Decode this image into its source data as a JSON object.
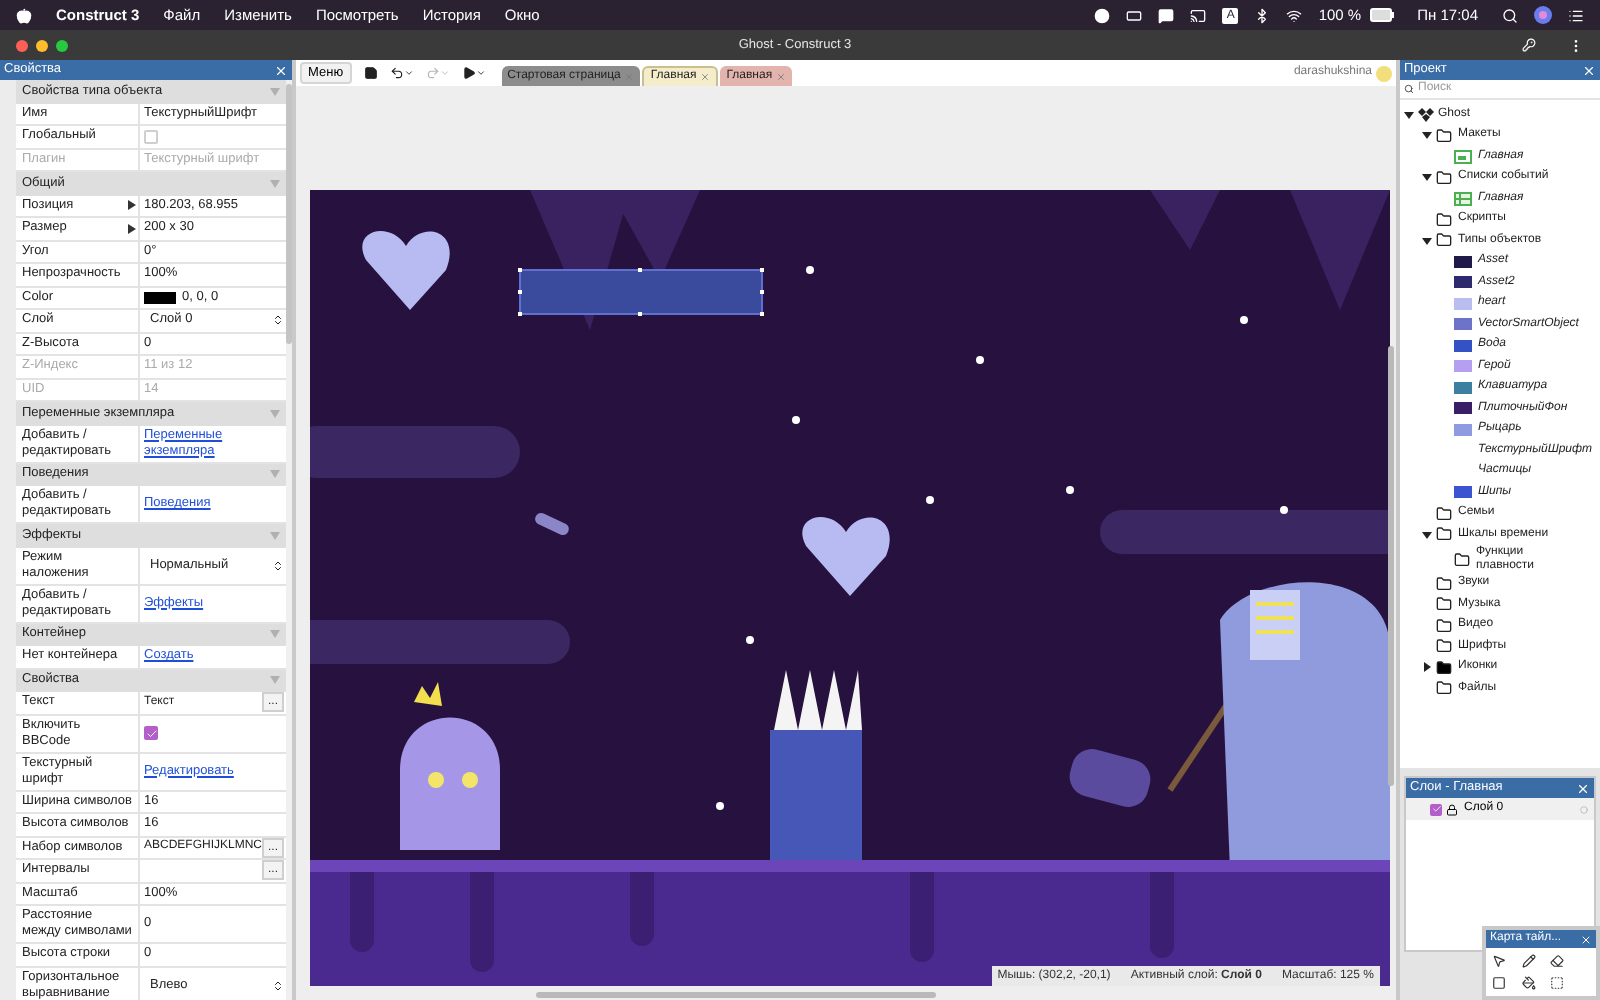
{
  "menubar": {
    "app": "Construct 3",
    "menus": [
      "Файл",
      "Изменить",
      "Посмотреть",
      "История",
      "Окно"
    ],
    "input_source": "A",
    "battery": "100 %",
    "clock": "Пн 17:04"
  },
  "window": {
    "title": "Ghost - Construct 3"
  },
  "properties_panel": {
    "title": "Свойства",
    "sections": [
      {
        "title": "Свойства типа объекта",
        "expanded": true,
        "rows": [
          {
            "kind": "text",
            "label": "Имя",
            "value": "ТекстурныйШрифт"
          },
          {
            "kind": "checkbox",
            "label": "Глобальный",
            "checked": false
          },
          {
            "kind": "readonly",
            "label": "Плагин",
            "value": "Текстурный шрифт"
          }
        ]
      },
      {
        "title": "Общий",
        "expanded": true,
        "rows": [
          {
            "kind": "vector",
            "label": "Позиция",
            "value": "180.203,  68.955"
          },
          {
            "kind": "vector",
            "label": "Размер",
            "value": "200 x 30"
          },
          {
            "kind": "text",
            "label": "Угол",
            "value": "0°"
          },
          {
            "kind": "text",
            "label": "Непрозрачность",
            "value": "100%"
          },
          {
            "kind": "color",
            "label": "Color",
            "value": "0, 0, 0",
            "color": "#000000"
          },
          {
            "kind": "select",
            "label": "Слой",
            "value": "Слой 0"
          },
          {
            "kind": "text",
            "label": "Z-Высота",
            "value": "0"
          },
          {
            "kind": "readonly",
            "label": "Z-Индекс",
            "value": "11 из 12"
          },
          {
            "kind": "readonly",
            "label": "UID",
            "value": "14"
          }
        ]
      },
      {
        "title": "Переменные экземпляра",
        "expanded": true,
        "rows": [
          {
            "kind": "link",
            "label": "Добавить / редактировать",
            "value": "Переменные экземпляра"
          }
        ]
      },
      {
        "title": "Поведения",
        "expanded": true,
        "rows": [
          {
            "kind": "link",
            "label": "Добавить / редактировать",
            "value": "Поведения"
          }
        ]
      },
      {
        "title": "Эффекты",
        "expanded": true,
        "rows": [
          {
            "kind": "select",
            "label": "Режим наложения",
            "value": "Нормальный"
          },
          {
            "kind": "link",
            "label": "Добавить / редактировать",
            "value": "Эффекты"
          }
        ]
      },
      {
        "title": "Контейнер",
        "expanded": true,
        "rows": [
          {
            "kind": "link",
            "label": "Нет контейнера",
            "value": "Создать"
          }
        ]
      },
      {
        "title": "Свойства",
        "expanded": true,
        "rows": [
          {
            "kind": "button",
            "label": "Текст",
            "value": "Текст",
            "button": "..."
          },
          {
            "kind": "checkbox",
            "label": "Включить BBCode",
            "checked": true
          },
          {
            "kind": "link",
            "label": "Текстурный шрифт",
            "value": "Редактировать"
          },
          {
            "kind": "text",
            "label": "Ширина символов",
            "value": "16"
          },
          {
            "kind": "text",
            "label": "Высота символов",
            "value": "16"
          },
          {
            "kind": "button",
            "label": "Набор символов",
            "value": "ABCDEFGHIJKLMNC",
            "button": "..."
          },
          {
            "kind": "button",
            "label": "Интервалы",
            "button": "..."
          },
          {
            "kind": "text",
            "label": "Масштаб",
            "value": "100%"
          },
          {
            "kind": "text",
            "label": "Расстояние между символами",
            "value": "0"
          },
          {
            "kind": "text",
            "label": "Высота строки",
            "value": "0"
          },
          {
            "kind": "select",
            "label": "Горизонтальное выравнивание",
            "value": "Влево"
          }
        ]
      }
    ]
  },
  "toolbar": {
    "menu_button": "Меню",
    "buttons": [
      {
        "kind": "save",
        "disabled": false
      },
      {
        "kind": "undo",
        "disabled": false
      },
      {
        "kind": "redo",
        "disabled": true
      },
      {
        "kind": "play",
        "disabled": false
      }
    ],
    "tabs": [
      {
        "label": "Стартовая страница",
        "selected": false,
        "color": "#8c8c8c"
      },
      {
        "label": "Главная",
        "selected": true,
        "color": "#f4eccb"
      },
      {
        "label": "Главная",
        "selected": false,
        "color": "#e3b4ad"
      }
    ],
    "user": "darashukshina"
  },
  "status_bar": [
    "Мышь: (302,2, -20,1)",
    "Активный слой: **Слой 0**",
    "Масштаб: 125 %"
  ],
  "project_panel": {
    "title": "Проект",
    "search": {
      "placeholder": "Поиск"
    },
    "tree": [
      {
        "kind": "project",
        "label": "Ghost",
        "expanded": true,
        "children": [
          {
            "kind": "folder",
            "label": "Макеты",
            "expanded": true,
            "children": [
              {
                "kind": "layout",
                "label": "Главная"
              }
            ]
          },
          {
            "kind": "folder",
            "label": "Списки событий",
            "expanded": true,
            "children": [
              {
                "kind": "eventsheet",
                "label": "Главная"
              }
            ]
          },
          {
            "kind": "folder",
            "label": "Скрипты"
          },
          {
            "kind": "folder",
            "label": "Типы объектов",
            "expanded": true,
            "children": [
              {
                "kind": "object",
                "label": "Asset",
                "color": "#1f1a4a"
              },
              {
                "kind": "object",
                "label": "Asset2",
                "color": "#2d2a6e"
              },
              {
                "kind": "object",
                "label": "heart",
                "color": "#b9bdf0"
              },
              {
                "kind": "object",
                "label": "VectorSmartObject",
                "color": "#6d73c9"
              },
              {
                "kind": "object",
                "label": "Вода",
                "color": "#3552c4"
              },
              {
                "kind": "object",
                "label": "Герой",
                "color": "#b49ff0"
              },
              {
                "kind": "object",
                "label": "Клавиатура",
                "color": "#3d7fa0"
              },
              {
                "kind": "object",
                "label": "ПлиточныйФон",
                "color": "#3a1f66"
              },
              {
                "kind": "object",
                "label": "Рыцарь",
                "color": "#8f9be0"
              },
              {
                "kind": "object",
                "label": "ТекстурныйШрифт"
              },
              {
                "kind": "object",
                "label": "Частицы"
              },
              {
                "kind": "object",
                "label": "Шипы",
                "color": "#3b55d0"
              }
            ]
          },
          {
            "kind": "folder",
            "label": "Семьи"
          },
          {
            "kind": "folder",
            "label": "Шкалы времени",
            "expanded": true,
            "children": [
              {
                "kind": "folder",
                "label": "Функции плавности"
              }
            ]
          },
          {
            "kind": "folder",
            "label": "Звуки"
          },
          {
            "kind": "folder",
            "label": "Музыка"
          },
          {
            "kind": "folder",
            "label": "Видео"
          },
          {
            "kind": "folder",
            "label": "Шрифты"
          },
          {
            "kind": "folder",
            "label": "Иконки",
            "expanded": false
          },
          {
            "kind": "folder",
            "label": "Файлы"
          }
        ]
      }
    ]
  },
  "layers_panel": {
    "title": "Слои - Главная",
    "layers": [
      {
        "name": "Слой 0",
        "visible": true
      }
    ]
  },
  "tilemap_panel": {
    "title": "Карта тайл..."
  }
}
